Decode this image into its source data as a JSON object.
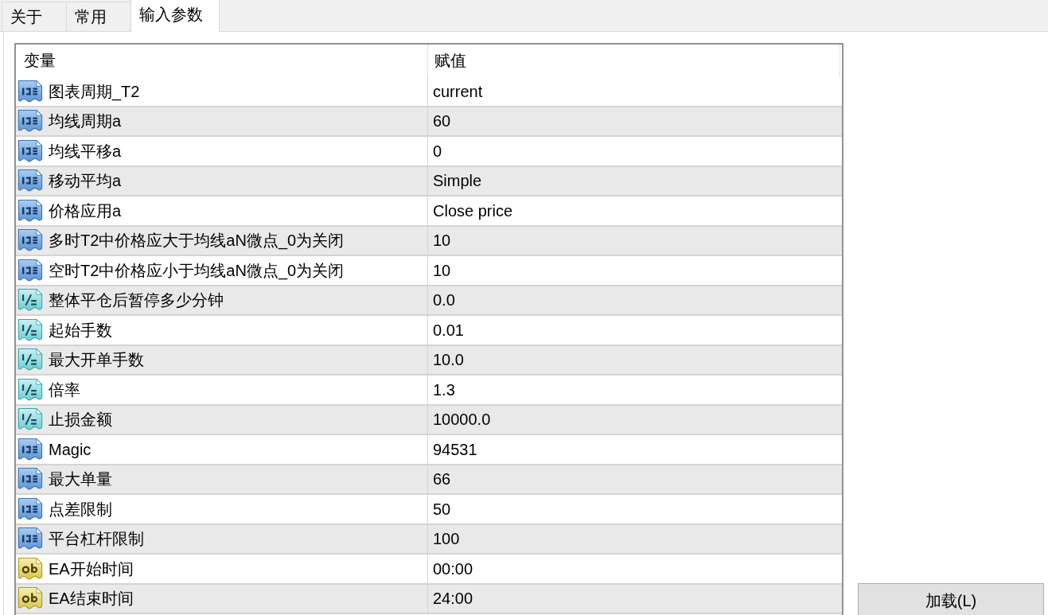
{
  "tabs": [
    {
      "label": "关于",
      "selected": false
    },
    {
      "label": "常用",
      "selected": false
    },
    {
      "label": "输入参数",
      "selected": true
    }
  ],
  "table": {
    "columns": [
      "变量",
      "赋值"
    ],
    "rows": [
      {
        "kind": "int",
        "name": "图表周期_T2",
        "value": "current"
      },
      {
        "kind": "int",
        "name": "均线周期a",
        "value": "60"
      },
      {
        "kind": "int",
        "name": "均线平移a",
        "value": "0"
      },
      {
        "kind": "int",
        "name": "移动平均a",
        "value": "Simple"
      },
      {
        "kind": "int",
        "name": "价格应用a",
        "value": "Close price"
      },
      {
        "kind": "int",
        "name": "多时T2中价格应大于均线aN微点_0为关闭",
        "value": "10"
      },
      {
        "kind": "int",
        "name": "空时T2中价格应小于均线aN微点_0为关闭",
        "value": "10"
      },
      {
        "kind": "double",
        "name": "整体平仓后暂停多少分钟",
        "value": "0.0"
      },
      {
        "kind": "double",
        "name": "起始手数",
        "value": "0.01"
      },
      {
        "kind": "double",
        "name": "最大开单手数",
        "value": "10.0"
      },
      {
        "kind": "double",
        "name": "倍率",
        "value": "1.3"
      },
      {
        "kind": "double",
        "name": "止损金额",
        "value": "10000.0"
      },
      {
        "kind": "int",
        "name": "Magic",
        "value": "94531"
      },
      {
        "kind": "int",
        "name": "最大单量",
        "value": "66"
      },
      {
        "kind": "int",
        "name": "点差限制",
        "value": "50"
      },
      {
        "kind": "int",
        "name": "平台杠杆限制",
        "value": "100"
      },
      {
        "kind": "string",
        "name": "EA开始时间",
        "value": "00:00"
      },
      {
        "kind": "string",
        "name": "EA结束时间",
        "value": "24:00"
      }
    ]
  },
  "load_button": {
    "label": "加载(L)"
  }
}
